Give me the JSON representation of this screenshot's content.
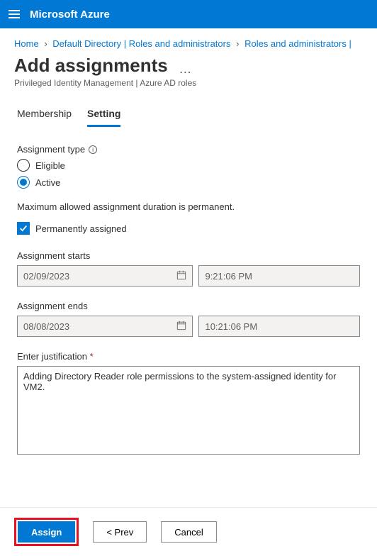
{
  "topbar": {
    "brand": "Microsoft Azure"
  },
  "breadcrumb": {
    "home": "Home",
    "dir": "Default Directory | Roles and administrators",
    "roles": "Roles and administrators |"
  },
  "page": {
    "title": "Add assignments",
    "subtitle": "Privileged Identity Management | Azure AD roles"
  },
  "tabs": {
    "membership": "Membership",
    "setting": "Setting"
  },
  "form": {
    "assignment_type_label": "Assignment type",
    "eligible": "Eligible",
    "active": "Active",
    "max_msg": "Maximum allowed assignment duration is permanent.",
    "permanently_assigned": "Permanently assigned",
    "starts_label": "Assignment starts",
    "start_date": "02/09/2023",
    "start_time": "9:21:06 PM",
    "ends_label": "Assignment ends",
    "end_date": "08/08/2023",
    "end_time": "10:21:06 PM",
    "justification_label": "Enter justification",
    "justification_value": "Adding Directory Reader role permissions to the system-assigned identity for VM2."
  },
  "buttons": {
    "assign": "Assign",
    "prev": "<  Prev",
    "cancel": "Cancel"
  }
}
